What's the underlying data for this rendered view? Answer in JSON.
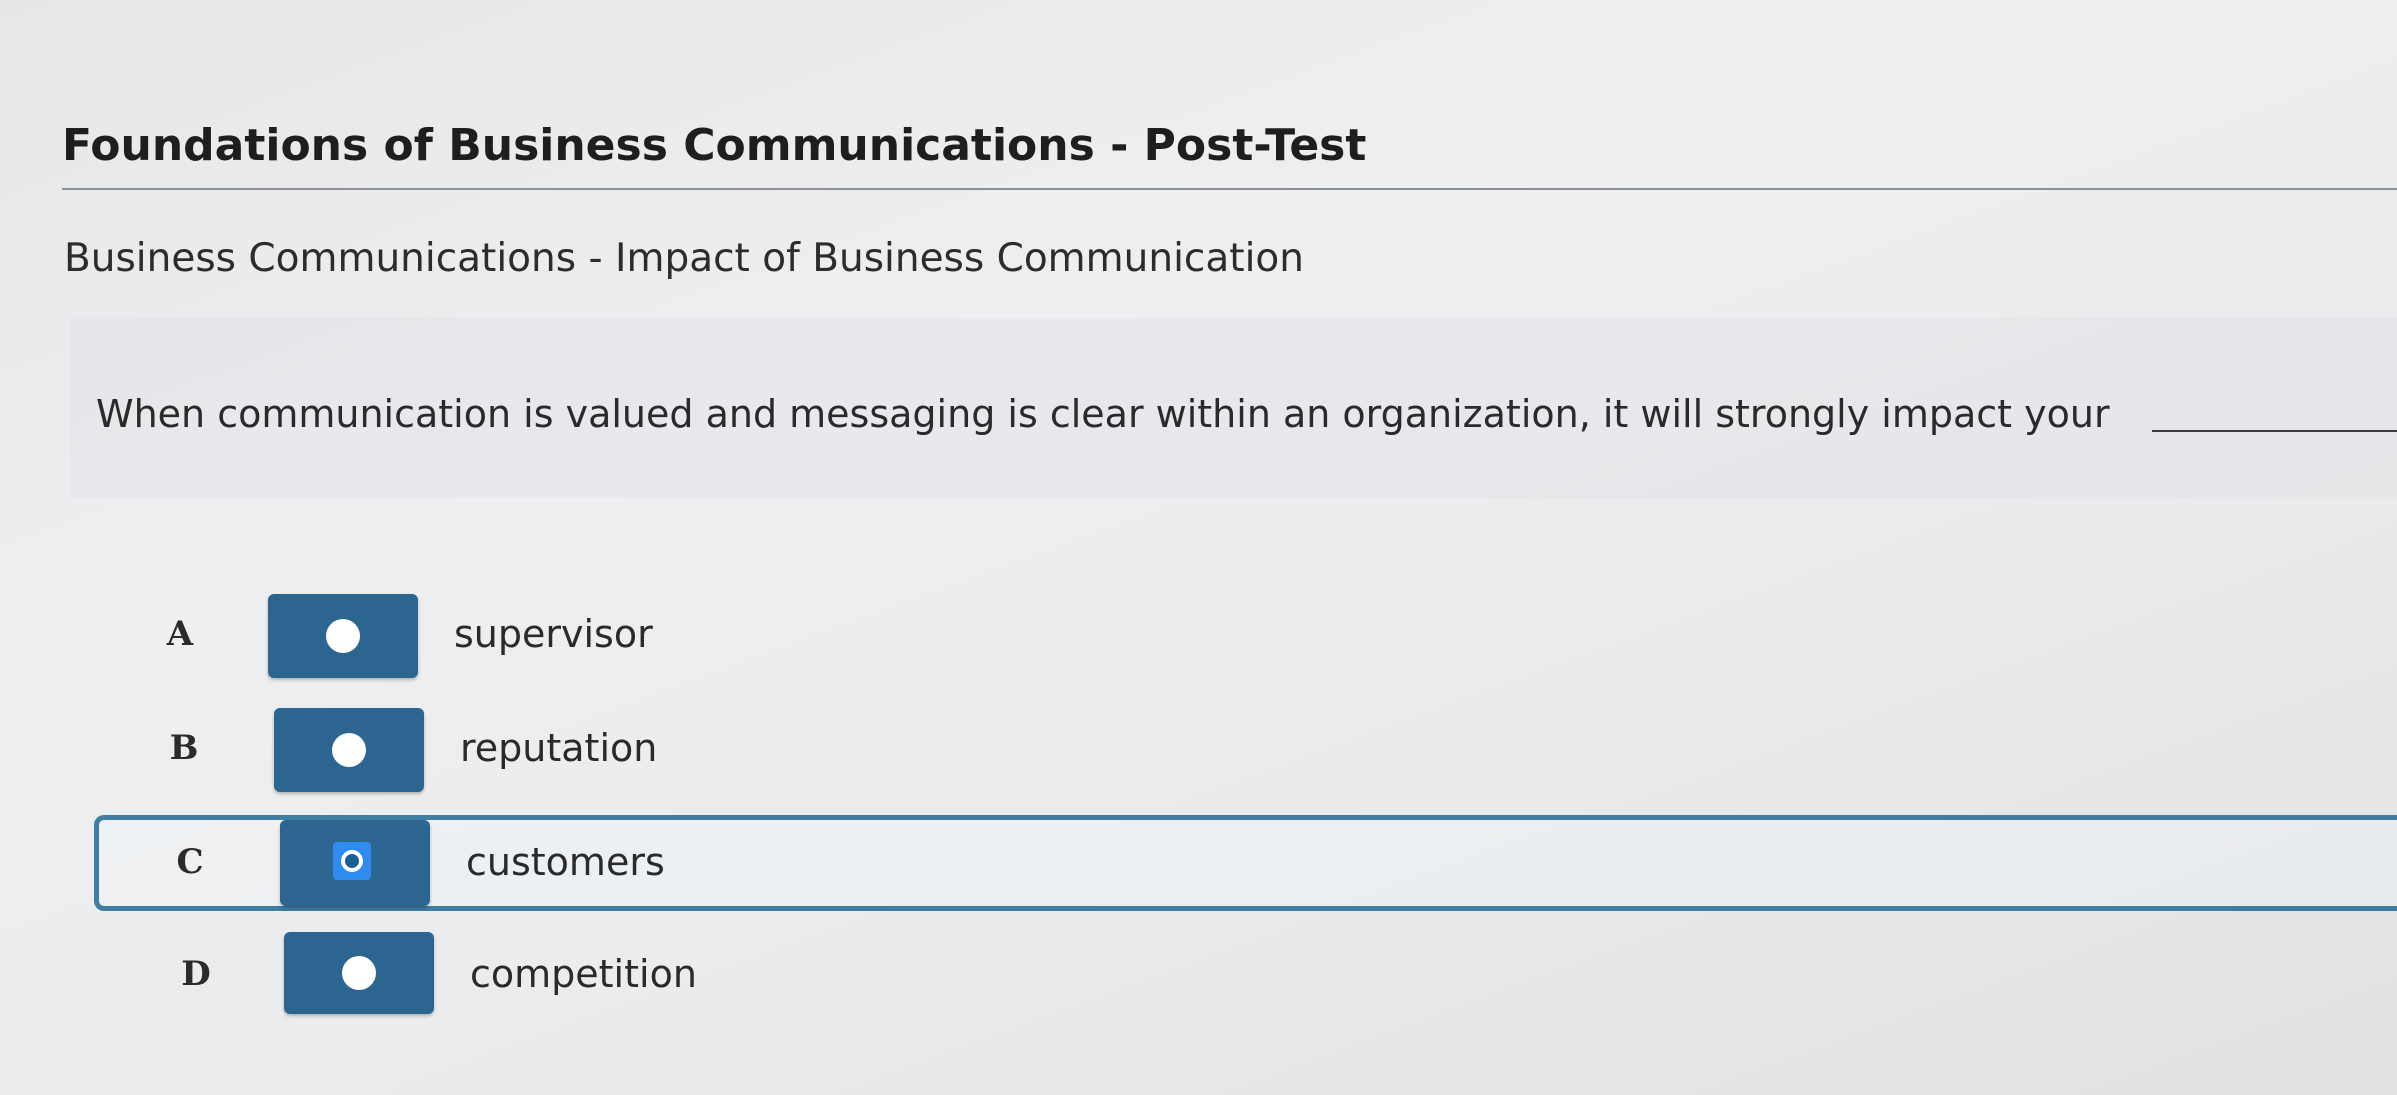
{
  "page": {
    "title": "Foundations of Business Communications - Post-Test",
    "subtitle": "Business Communications - Impact of Business Communication"
  },
  "question": {
    "text": "When communication is valued and messaging is clear within an organization, it will strongly impact your"
  },
  "options": [
    {
      "letter": "A",
      "label": "supervisor",
      "selected": false
    },
    {
      "letter": "B",
      "label": "reputation",
      "selected": false
    },
    {
      "letter": "C",
      "label": "customers",
      "selected": true
    },
    {
      "letter": "D",
      "label": "competition",
      "selected": false
    }
  ],
  "colors": {
    "radio_box": "#2b6590",
    "selected_border": "#3e7ea3",
    "focus": "#2f8bf0"
  }
}
